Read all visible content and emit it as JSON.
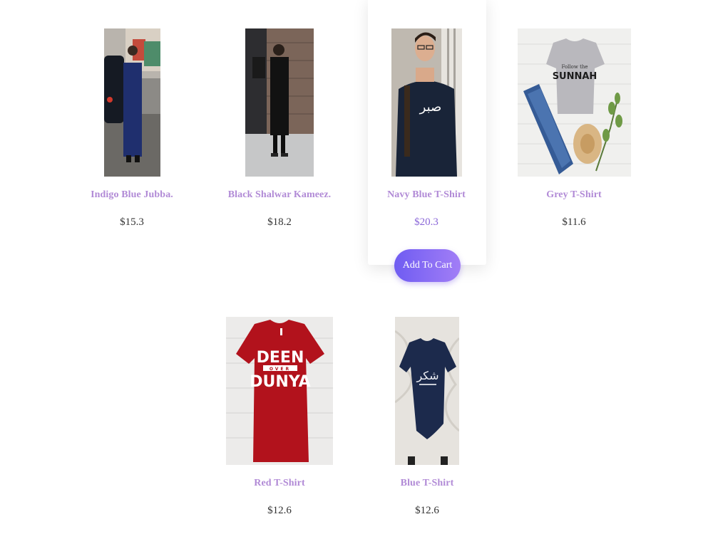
{
  "products": [
    {
      "name": "Indigo Blue Jubba.",
      "price": "$15.3"
    },
    {
      "name": "Black Shalwar Kameez.",
      "price": "$18.2"
    },
    {
      "name": "Navy Blue T-Shirt",
      "price": "$20.3"
    },
    {
      "name": "Grey T-Shirt",
      "price": "$11.6"
    },
    {
      "name": "Red T-Shirt",
      "price": "$12.6"
    },
    {
      "name": "Blue T-Shirt",
      "price": "$12.6"
    }
  ],
  "active_card": {
    "add_to_cart_label": "Add To Cart"
  },
  "image_text": {
    "navy_shirt_print": "صبر",
    "grey_shirt_script": "Follow the",
    "grey_shirt_print": "SUNNAH",
    "red_shirt_line1": "DEEN",
    "red_shirt_line2": "OVER",
    "red_shirt_line3": "DUNYA",
    "blue_shirt_print": "شكر"
  },
  "colors": {
    "product_name": "#b18ad6",
    "price": "#333333",
    "active_price": "#8a66d8",
    "button_gradient_start": "#6f5cf2",
    "button_gradient_end": "#a27ef6"
  }
}
